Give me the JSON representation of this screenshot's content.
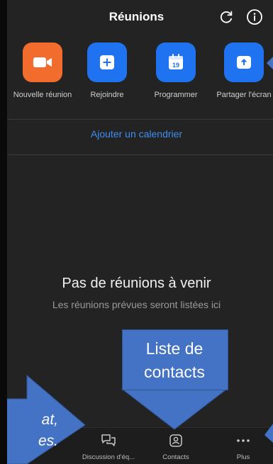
{
  "header": {
    "title": "Réunions"
  },
  "actions": [
    {
      "label": "Nouvelle réunion",
      "color": "#f26d2d",
      "icon": "video-camera-icon"
    },
    {
      "label": "Rejoindre",
      "color": "#1f72f0",
      "icon": "plus-icon"
    },
    {
      "label": "Programmer",
      "color": "#1f72f0",
      "icon": "calendar-icon",
      "calendar_day": "19"
    },
    {
      "label": "Partager l'écran",
      "color": "#1f72f0",
      "icon": "share-screen-icon"
    }
  ],
  "calendar_link": "Ajouter un calendrier",
  "empty_state": {
    "title": "Pas de réunions à venir",
    "subtitle": "Les réunions prévues seront listées ici"
  },
  "tabs": [
    {
      "label": "Discussion d'éq...",
      "icon": "chat-bubbles-icon"
    },
    {
      "label": "Contacts",
      "icon": "contacts-icon"
    },
    {
      "label": "Plus",
      "icon": "more-dots-icon"
    }
  ],
  "annotations": {
    "contacts_callout": {
      "line1": "Liste de",
      "line2": "contacts",
      "color": "#4472c4"
    },
    "chat_callout": {
      "line1": "at,",
      "line2": "es."
    }
  }
}
